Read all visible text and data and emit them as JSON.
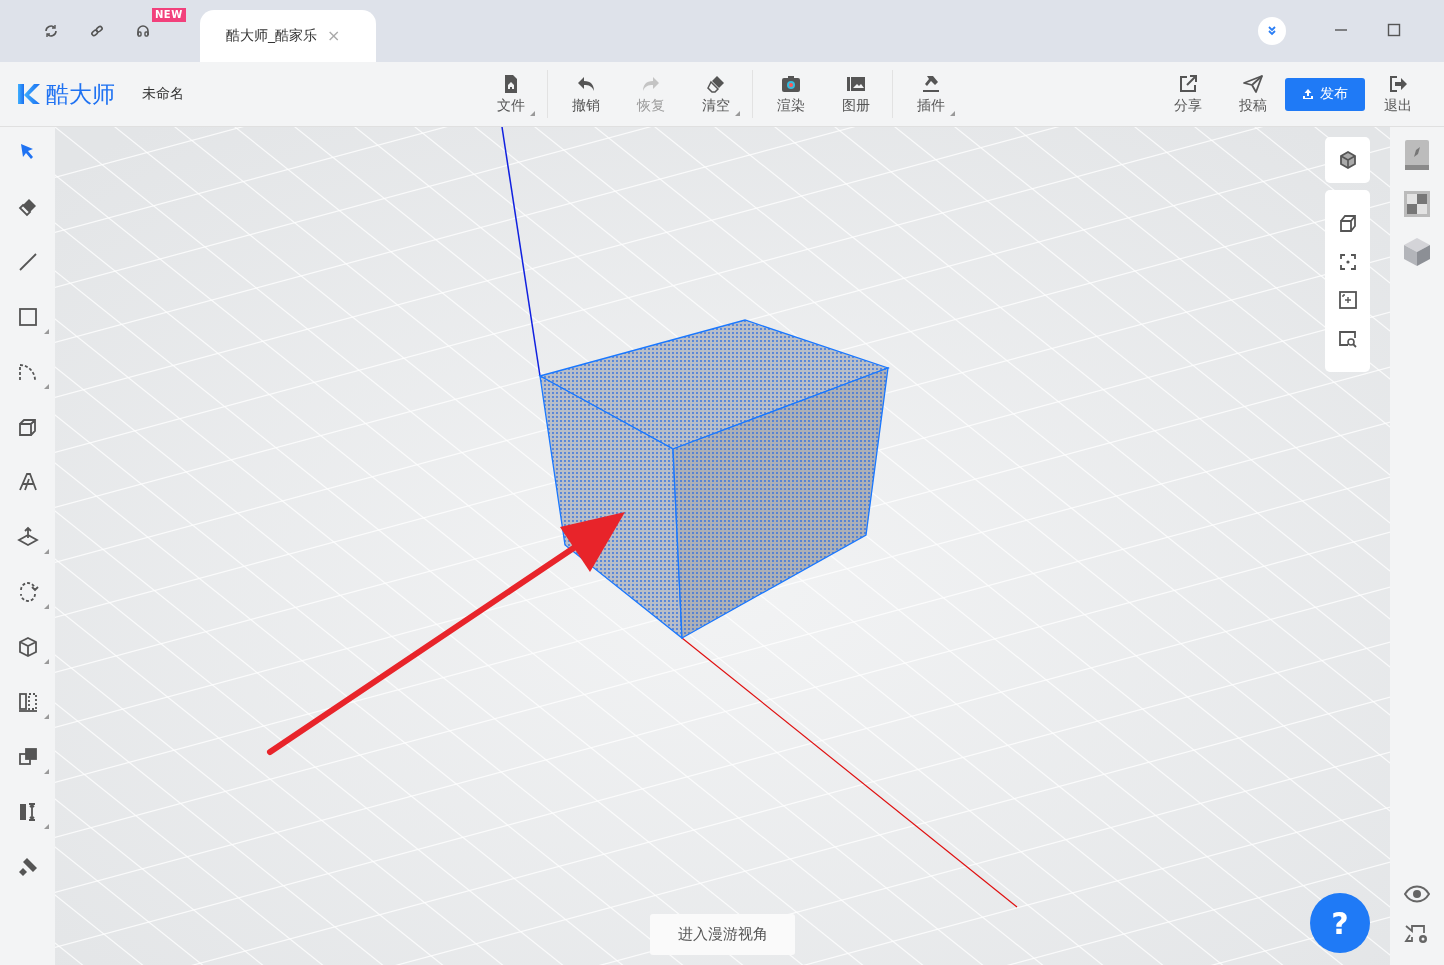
{
  "title_bar": {
    "badge": "NEW",
    "tab": {
      "title": "酷大师_酷家乐",
      "close": "×"
    }
  },
  "toolbar": {
    "app_name": "酷大师",
    "file_name": "未命名",
    "groups": [
      [
        {
          "label": "文件",
          "has_menu": true,
          "disabled": false
        }
      ],
      [
        {
          "label": "撤销",
          "has_menu": false,
          "disabled": false
        },
        {
          "label": "恢复",
          "has_menu": false,
          "disabled": true
        },
        {
          "label": "清空",
          "has_menu": true,
          "disabled": false
        }
      ],
      [
        {
          "label": "渲染",
          "has_menu": false,
          "disabled": false
        },
        {
          "label": "图册",
          "has_menu": false,
          "disabled": false
        }
      ],
      [
        {
          "label": "插件",
          "has_menu": true,
          "disabled": false
        }
      ]
    ],
    "actions": [
      {
        "label": "分享",
        "kind": "tool"
      },
      {
        "label": "投稿",
        "kind": "tool"
      },
      {
        "label": "发布",
        "kind": "primary"
      },
      {
        "label": "退出",
        "kind": "tool"
      }
    ]
  },
  "tools": [
    {
      "selected": true,
      "has_menu": false
    },
    {
      "selected": false,
      "has_menu": false
    },
    {
      "selected": false,
      "has_menu": false
    },
    {
      "selected": false,
      "has_menu": true
    },
    {
      "selected": false,
      "has_menu": true
    },
    {
      "selected": false,
      "has_menu": false
    },
    {
      "selected": false,
      "has_menu": false
    },
    {
      "selected": false,
      "has_menu": true
    },
    {
      "selected": false,
      "has_menu": true
    },
    {
      "selected": false,
      "has_menu": true
    },
    {
      "selected": false,
      "has_menu": true
    },
    {
      "selected": false,
      "has_menu": true
    },
    {
      "selected": false,
      "has_menu": true
    },
    {
      "selected": false,
      "has_menu": false
    }
  ],
  "view_button": "进入漫游视角",
  "help_button": "?"
}
